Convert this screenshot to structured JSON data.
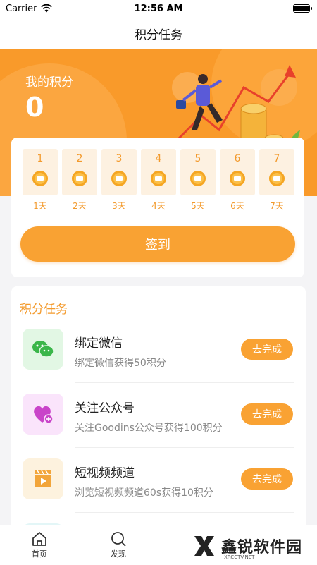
{
  "status_bar": {
    "carrier": "Carrier",
    "time": "12:56 AM"
  },
  "nav": {
    "title": "积分任务"
  },
  "hero": {
    "label": "我的积分",
    "points": "0"
  },
  "signin": {
    "days": [
      {
        "num": "1",
        "label": "1天"
      },
      {
        "num": "2",
        "label": "2天"
      },
      {
        "num": "3",
        "label": "3天"
      },
      {
        "num": "4",
        "label": "4天"
      },
      {
        "num": "5",
        "label": "5天"
      },
      {
        "num": "6",
        "label": "6天"
      },
      {
        "num": "7",
        "label": "7天"
      }
    ],
    "button_label": "签到"
  },
  "tasks": {
    "title": "积分任务",
    "items": [
      {
        "name": "绑定微信",
        "desc": "绑定微信获得50积分",
        "button": "去完成",
        "icon": "wechat-icon",
        "color": "#e2f7e4"
      },
      {
        "name": "关注公众号",
        "desc": "关注Goodins公众号获得100积分",
        "button": "去完成",
        "icon": "heart-plus-icon",
        "color": "#fae4fb"
      },
      {
        "name": "短视频频道",
        "desc": "浏览短视频频道60s获得10积分",
        "button": "去完成",
        "icon": "video-icon",
        "color": "#fdf2de"
      }
    ]
  },
  "tab_bar": {
    "tabs": [
      {
        "label": "首页",
        "icon": "home-icon"
      },
      {
        "label": "发现",
        "icon": "discover-icon"
      }
    ]
  },
  "watermark": {
    "text": "鑫锐软件园",
    "sub": "XRCCTV.NET"
  },
  "colors": {
    "accent": "#f9a233",
    "hero_bg": "#f99a2a"
  }
}
